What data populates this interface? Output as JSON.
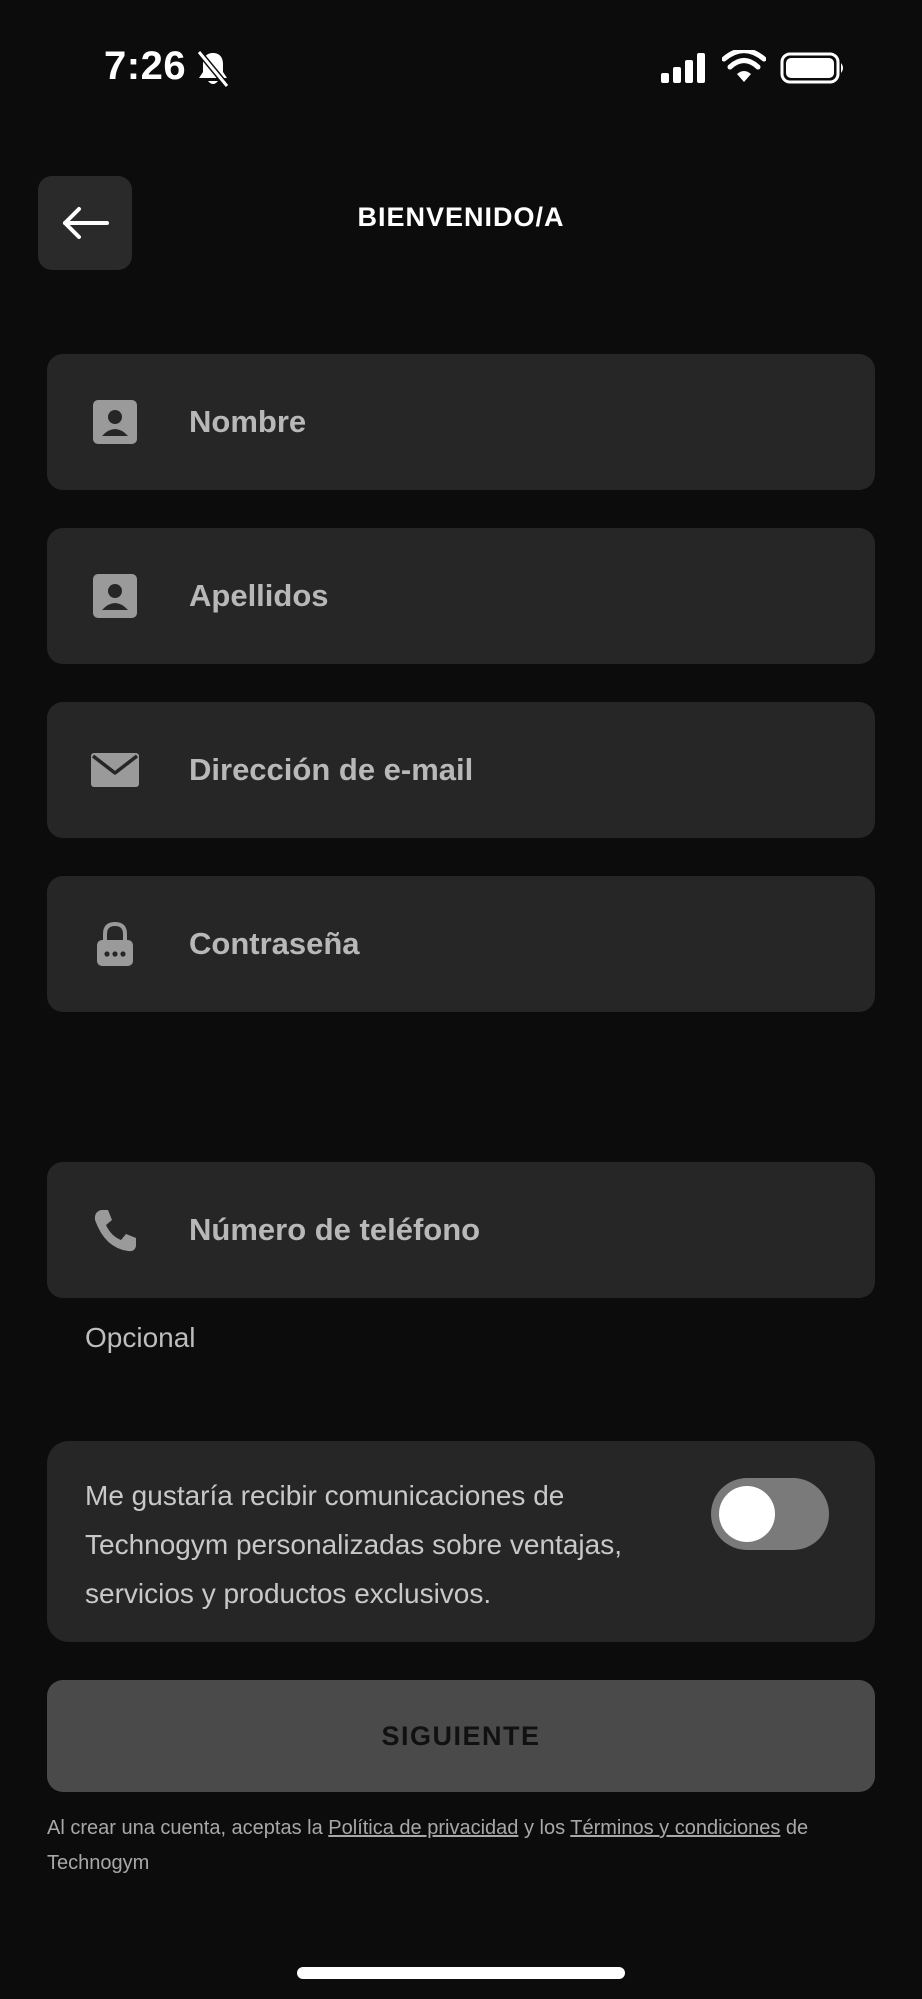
{
  "status_bar": {
    "time": "7:26",
    "icons": [
      "bell-slash-icon",
      "signal-icon",
      "wifi-icon",
      "battery-icon"
    ]
  },
  "header": {
    "title": "BIENVENIDO/A",
    "back_icon": "arrow-left-icon"
  },
  "form": {
    "first_name": {
      "placeholder": "Nombre",
      "value": "",
      "icon": "contact-card-icon"
    },
    "last_name": {
      "placeholder": "Apellidos",
      "value": "",
      "icon": "contact-card-icon"
    },
    "email": {
      "placeholder": "Dirección de e-mail",
      "value": "",
      "icon": "envelope-icon"
    },
    "password": {
      "placeholder": "Contraseña",
      "value": "",
      "icon": "lock-icon"
    },
    "phone": {
      "placeholder": "Número de teléfono",
      "value": "",
      "icon": "phone-icon",
      "helper": "Opcional"
    }
  },
  "consent": {
    "text": "Me gustaría recibir comunicaciones de Technogym personalizadas sobre ventajas, servicios y productos exclusivos.",
    "enabled": false
  },
  "next_button": {
    "label": "SIGUIENTE"
  },
  "legal": {
    "prefix": "Al crear una cuenta, aceptas la ",
    "privacy_link": "Política de privacidad",
    "middle": " y los ",
    "terms_link": "Términos y condiciones",
    "suffix": " de Technogym"
  },
  "colors": {
    "background": "#0c0c0c",
    "field_background": "#262626",
    "button_background": "#4a4a4a",
    "toggle_off": "#7a7a7a"
  }
}
